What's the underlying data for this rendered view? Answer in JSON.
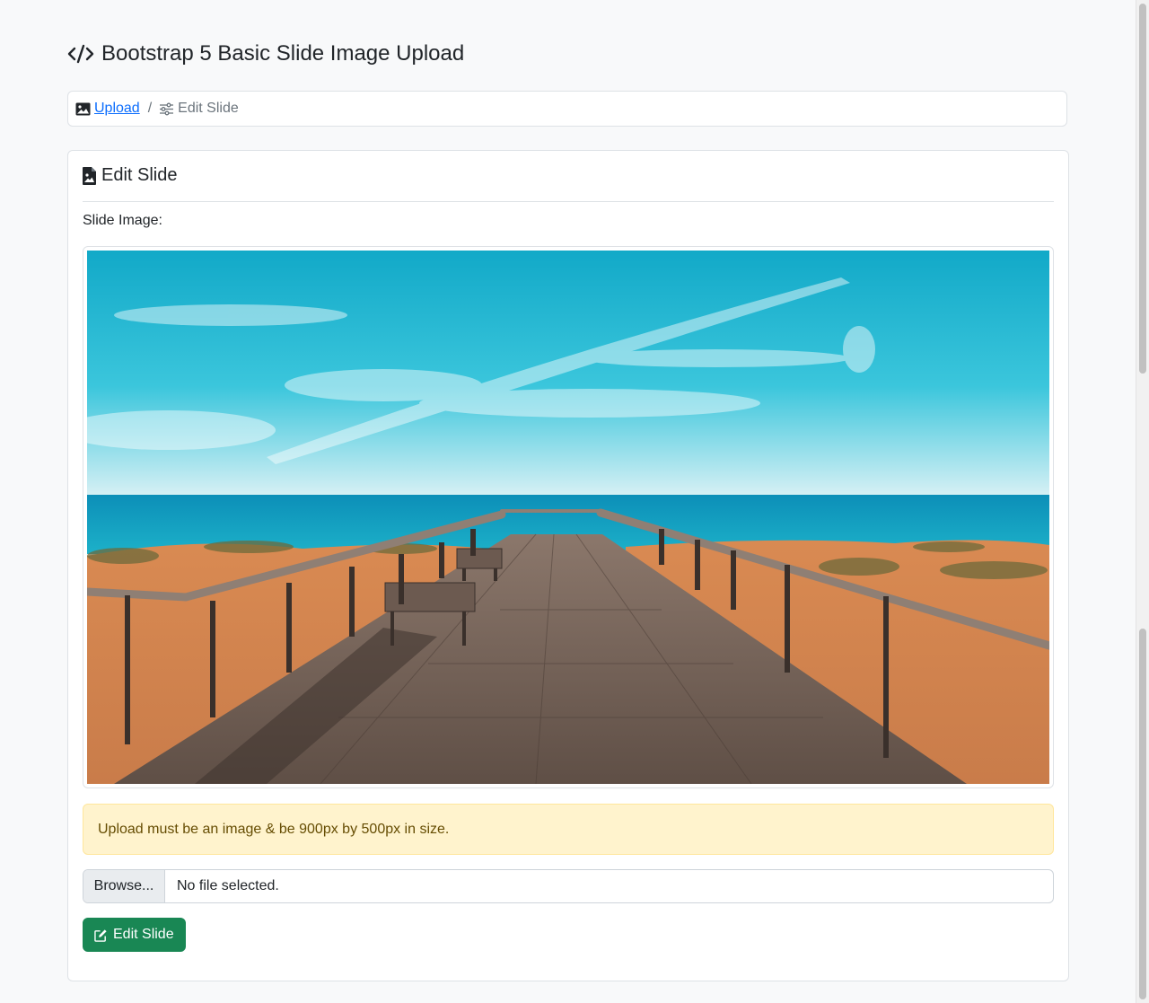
{
  "page": {
    "title": "Bootstrap 5 Basic Slide Image Upload",
    "title_icon": "code-slash-icon"
  },
  "breadcrumb": {
    "items": [
      {
        "label": "Upload",
        "icon": "image-icon",
        "link": true
      },
      {
        "label": "Edit Slide",
        "icon": "sliders-icon",
        "link": false
      }
    ],
    "separator": "/"
  },
  "card": {
    "title": "Edit Slide",
    "title_icon": "file-image-icon",
    "image_label": "Slide Image:",
    "alert": "Upload must be an image & be 900px by 500px in size.",
    "file_input": {
      "button_label": "Browse...",
      "status": "No file selected."
    },
    "submit": {
      "label": "Edit Slide",
      "icon": "pencil-square-icon"
    }
  },
  "colors": {
    "link": "#0d6efd",
    "success": "#198754",
    "warning_bg": "#fff3cd",
    "warning_text": "#664d03"
  }
}
